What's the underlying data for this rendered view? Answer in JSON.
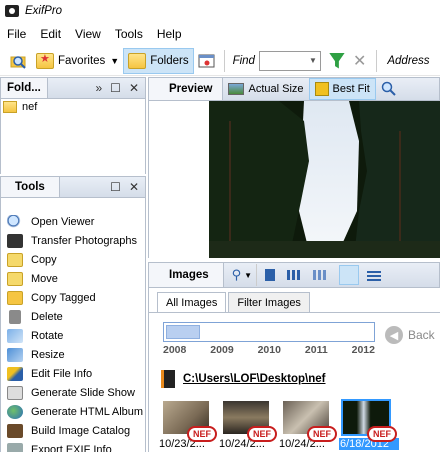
{
  "window": {
    "title": "ExifPro"
  },
  "menu": [
    "File",
    "Edit",
    "View",
    "Tools",
    "Help"
  ],
  "toolbar": {
    "favorites_label": "Favorites",
    "folders_label": "Folders",
    "find_label": "Find",
    "address_label": "Address"
  },
  "folders_panel": {
    "title": "Fold...",
    "items": [
      "nef"
    ]
  },
  "tools_panel": {
    "title": "Tools",
    "items": [
      "Open Viewer",
      "Transfer Photographs",
      "Copy",
      "Move",
      "Copy Tagged",
      "Delete",
      "Rotate",
      "Resize",
      "Edit File Info",
      "Generate Slide Show",
      "Generate HTML Album",
      "Build Image Catalog",
      "Export EXIF Info"
    ]
  },
  "preview_panel": {
    "title": "Preview",
    "actual_size_label": "Actual Size",
    "best_fit_label": "Best Fit"
  },
  "images_panel": {
    "title": "Images",
    "tabs": [
      "All Images",
      "Filter Images"
    ],
    "timeline_years": [
      "2008",
      "2009",
      "2010",
      "2011",
      "2012"
    ],
    "back_label": "Back",
    "path": "C:\\Users\\LOF\\Desktop\\nef",
    "badge": "NEF",
    "thumbnails": [
      {
        "date": "10/23/2..."
      },
      {
        "date": "10/24/2..."
      },
      {
        "date": "10/24/2..."
      },
      {
        "date": "6/18/2012"
      }
    ]
  },
  "colors": {
    "selection": "#3399ff",
    "active_button": "#cce4f7",
    "panel_header": "#d5dde9",
    "nef_badge": "#c81e1e"
  }
}
